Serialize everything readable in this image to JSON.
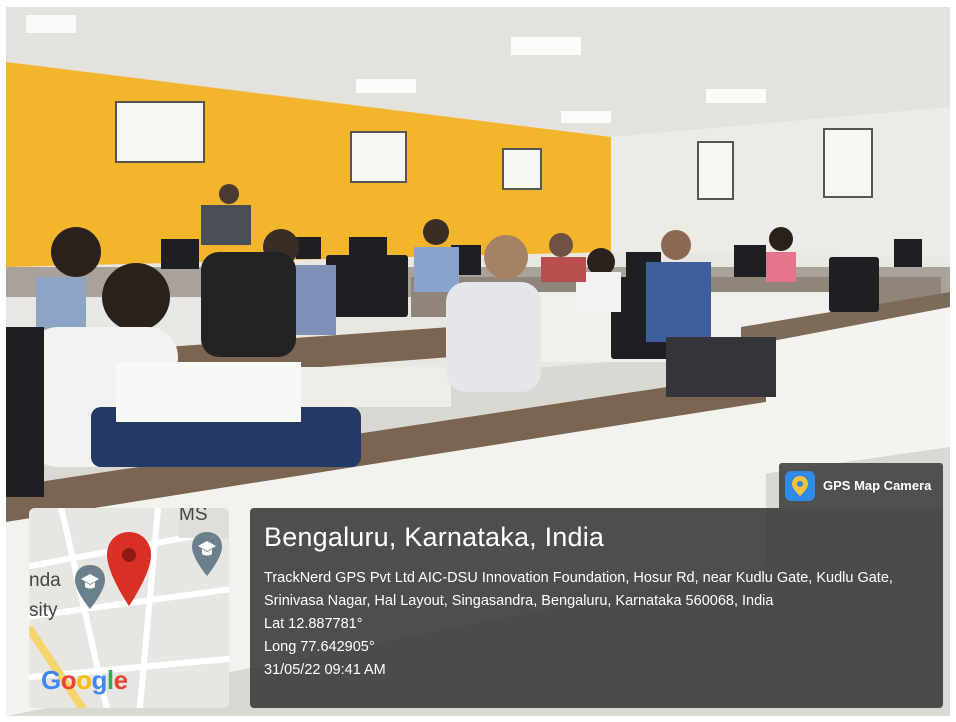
{
  "badge": {
    "label": "GPS Map Camera"
  },
  "location": {
    "title": "Bengaluru, Karnataka, India",
    "address": "TrackNerd GPS Pvt Ltd AIC-DSU Innovation Foundation, Hosur Rd, near Kudlu Gate, Kudlu Gate, Srinivasa Nagar, Hal Layout, Singasandra, Bengaluru, Karnataka 560068, India",
    "lat": "Lat 12.887781°",
    "long": "Long 77.642905°",
    "datetime": "31/05/22 09:41 AM"
  },
  "map": {
    "label_ms": "MS",
    "label_nda": "nda",
    "label_sity": "sity",
    "logo_letters": [
      "G",
      "o",
      "o",
      "g",
      "l",
      "e"
    ],
    "logo_colors": [
      "#4285F4",
      "#EA4335",
      "#FBBC05",
      "#4285F4",
      "#34A853",
      "#EA4335"
    ]
  },
  "colors": {
    "wall_accent": "#f2b52c",
    "overlay": "#373737",
    "pin": "#d93025"
  }
}
